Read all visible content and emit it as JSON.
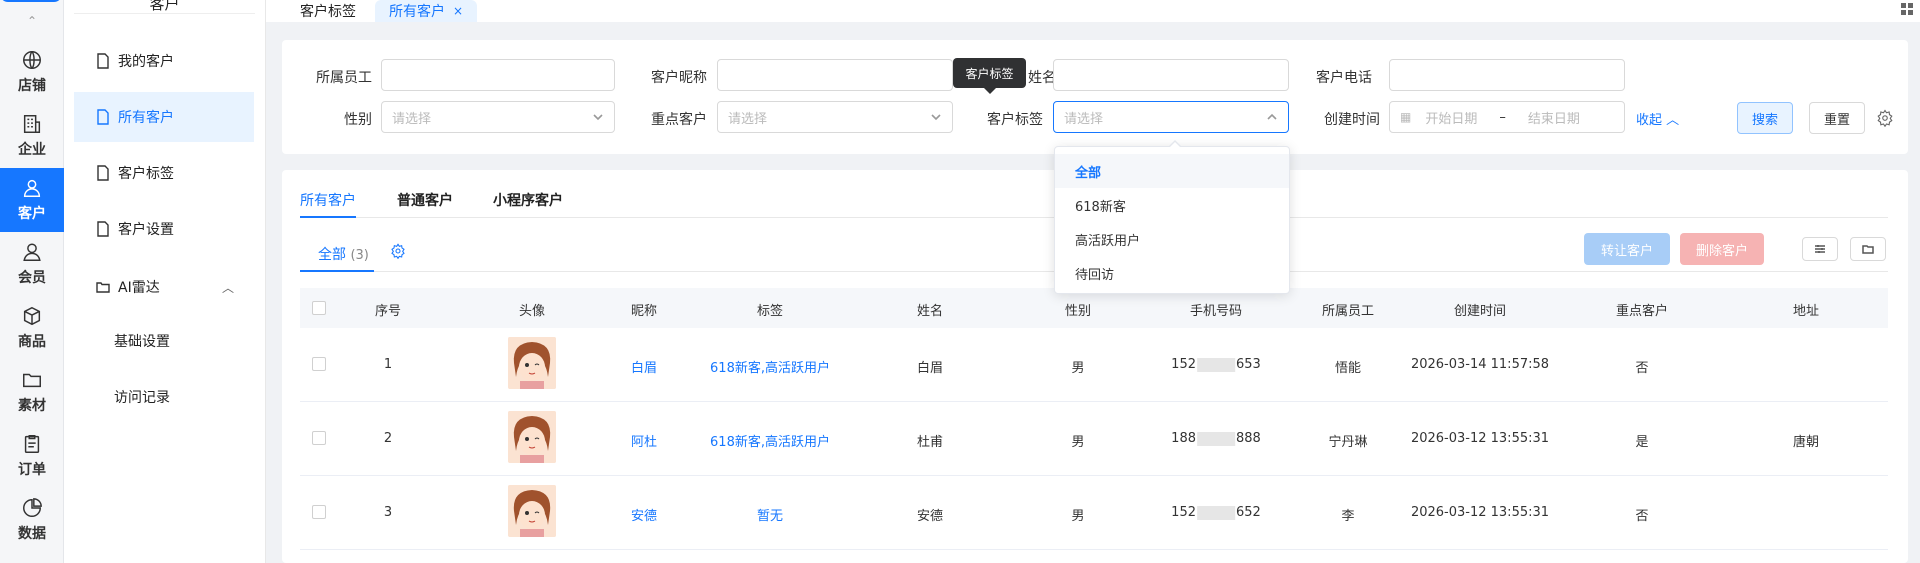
{
  "rail": {
    "items": [
      {
        "label": "店铺",
        "icon": "globe-icon"
      },
      {
        "label": "企业",
        "icon": "building-icon"
      },
      {
        "label": "客户",
        "icon": "customer-icon"
      },
      {
        "label": "会员",
        "icon": "member-icon"
      },
      {
        "label": "商品",
        "icon": "box-icon"
      },
      {
        "label": "素材",
        "icon": "folder-icon"
      },
      {
        "label": "订单",
        "icon": "clipboard-icon"
      },
      {
        "label": "数据",
        "icon": "pie-chart-icon"
      }
    ],
    "active_color": "#1677ff"
  },
  "submenu": {
    "title": "客户",
    "items": [
      {
        "label": "我的客户"
      },
      {
        "label": "所有客户"
      },
      {
        "label": "客户标签"
      },
      {
        "label": "客户设置"
      },
      {
        "label": "AI雷达"
      }
    ],
    "children": [
      {
        "label": "基础设置"
      },
      {
        "label": "访问记录"
      }
    ]
  },
  "tabs": [
    {
      "label": "客户标签"
    },
    {
      "label": "所有客户",
      "close": "×"
    }
  ],
  "filters": {
    "employee_label": "所属员工",
    "nickname_label": "客户昵称",
    "name_label_partial": "姓名",
    "phone_label": "客户电话",
    "gender_label": "性别",
    "gender_placeholder": "请选择",
    "key_label": "重点客户",
    "key_placeholder": "请选择",
    "tag_label": "客户标签",
    "tag_placeholder": "请选择",
    "created_label": "创建时间",
    "start_placeholder": "开始日期",
    "range_sep": "–",
    "end_placeholder": "结束日期",
    "collapse": "收起",
    "search": "搜索",
    "reset": "重置"
  },
  "tooltip": "客户标签",
  "dropdown": {
    "options": [
      "全部",
      "618新客",
      "高活跃用户",
      "待回访"
    ],
    "selected": "全部"
  },
  "main": {
    "tabs": [
      "所有客户",
      "普通客户",
      "小程序客户"
    ],
    "subtab_label": "全部",
    "subtab_count": "(3)",
    "transfer": "转让客户",
    "delete": "删除客户"
  },
  "table": {
    "columns": [
      "序号",
      "头像",
      "昵称",
      "标签",
      "姓名",
      "性别",
      "手机号码",
      "所属员工",
      "创建时间",
      "重点客户",
      "地址"
    ],
    "rows": [
      {
        "no": "1",
        "nickname": "白眉",
        "tags": "618新客,高活跃用户",
        "name": "白眉",
        "gender": "男",
        "phone_pre": "152",
        "phone_post": "653",
        "employee": "悟能",
        "created": "2026-03-14 11:57:58",
        "key": "否",
        "address": ""
      },
      {
        "no": "2",
        "nickname": "阿杜",
        "tags": "618新客,高活跃用户",
        "name": "杜甫",
        "gender": "男",
        "phone_pre": "188",
        "phone_post": "888",
        "employee": "宁丹琳",
        "created": "2026-03-12 13:55:31",
        "key": "是",
        "address": "唐朝"
      },
      {
        "no": "3",
        "nickname": "安德",
        "tags": "暂无",
        "name": "安德",
        "gender": "男",
        "phone_pre": "152",
        "phone_post": "652",
        "employee": "李",
        "created": "2026-03-12 13:55:31",
        "key": "否",
        "address": ""
      }
    ]
  }
}
